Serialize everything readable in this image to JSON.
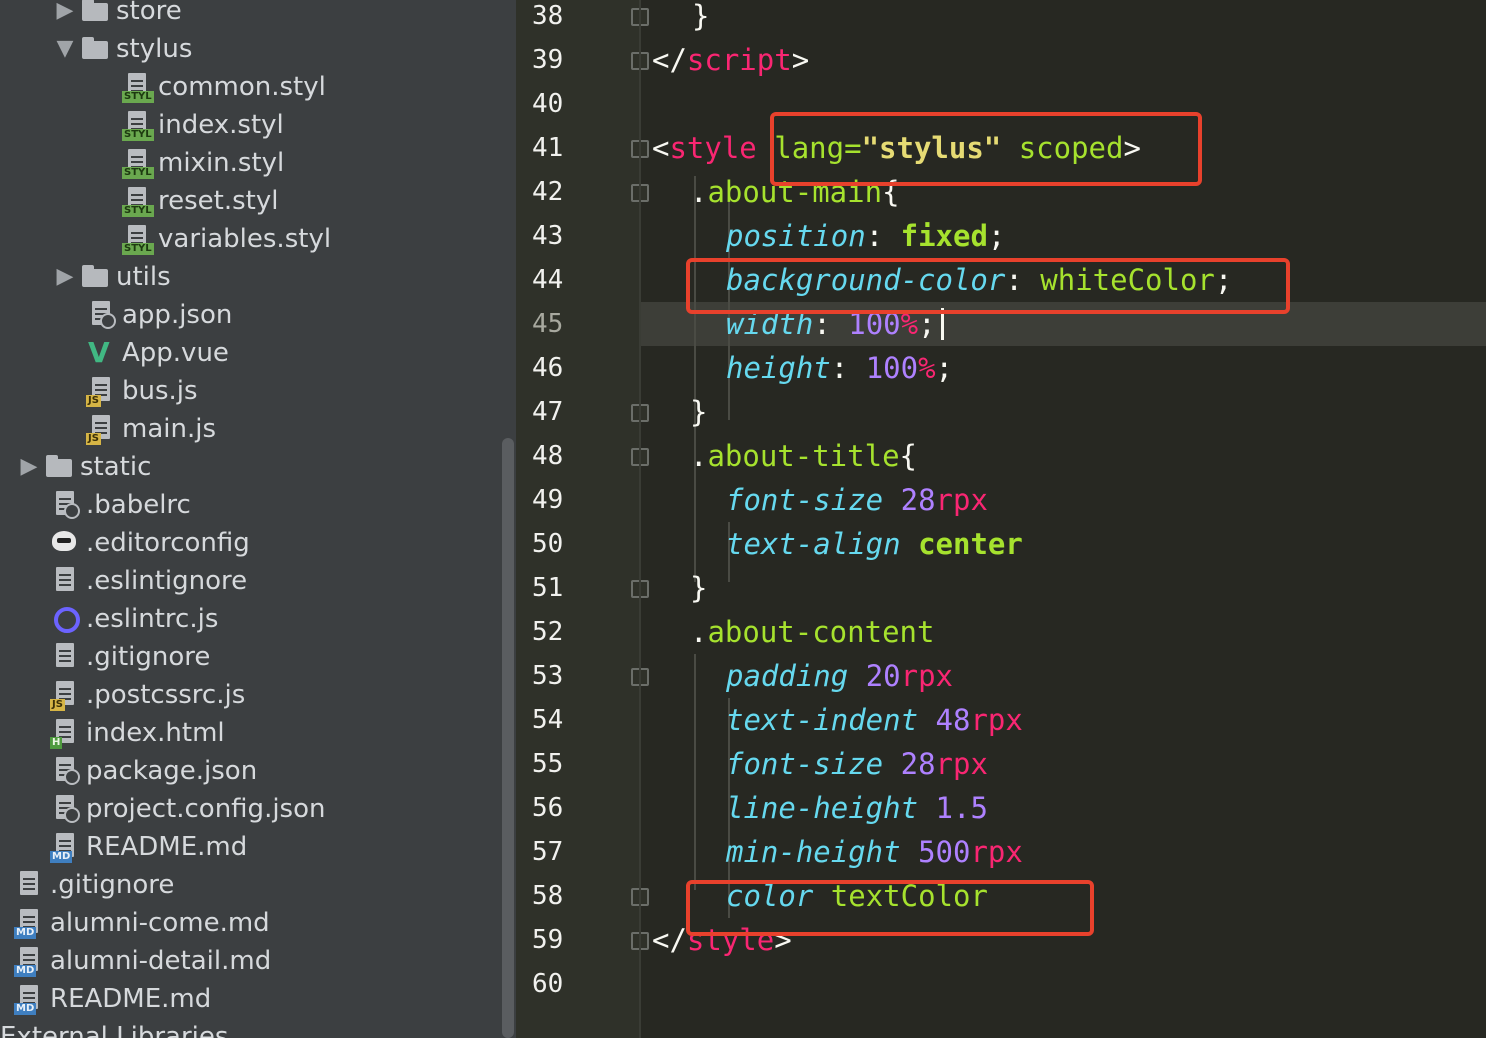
{
  "file_tree": [
    {
      "label": "store",
      "type": "folder",
      "state": "collapsed"
    },
    {
      "label": "stylus",
      "type": "folder",
      "state": "expanded"
    },
    {
      "label": "common.styl",
      "type": "file",
      "icon": "styl-file-icon"
    },
    {
      "label": "index.styl",
      "type": "file",
      "icon": "styl-file-icon"
    },
    {
      "label": "mixin.styl",
      "type": "file",
      "icon": "styl-file-icon"
    },
    {
      "label": "reset.styl",
      "type": "file",
      "icon": "styl-file-icon"
    },
    {
      "label": "variables.styl",
      "type": "file",
      "icon": "styl-file-icon"
    },
    {
      "label": "utils",
      "type": "folder",
      "state": "collapsed"
    },
    {
      "label": "app.json",
      "type": "file",
      "icon": "json-file-icon"
    },
    {
      "label": "App.vue",
      "type": "file",
      "icon": "vue-file-icon"
    },
    {
      "label": "bus.js",
      "type": "file",
      "icon": "js-file-icon"
    },
    {
      "label": "main.js",
      "type": "file",
      "icon": "js-file-icon"
    },
    {
      "label": "static",
      "type": "folder",
      "state": "collapsed"
    },
    {
      "label": ".babelrc",
      "type": "file",
      "icon": "config-file-icon"
    },
    {
      "label": ".editorconfig",
      "type": "file",
      "icon": "editorconfig-file-icon"
    },
    {
      "label": ".eslintignore",
      "type": "file",
      "icon": "text-file-icon"
    },
    {
      "label": ".eslintrc.js",
      "type": "file",
      "icon": "eslint-file-icon"
    },
    {
      "label": ".gitignore",
      "type": "file",
      "icon": "text-file-icon"
    },
    {
      "label": ".postcssrc.js",
      "type": "file",
      "icon": "js-file-icon"
    },
    {
      "label": "index.html",
      "type": "file",
      "icon": "html-file-icon"
    },
    {
      "label": "package.json",
      "type": "file",
      "icon": "json-file-icon"
    },
    {
      "label": "project.config.json",
      "type": "file",
      "icon": "json-file-icon"
    },
    {
      "label": "README.md",
      "type": "file",
      "icon": "md-file-icon"
    },
    {
      "label": ".gitignore",
      "type": "file",
      "icon": "text-file-icon"
    },
    {
      "label": "alumni-come.md",
      "type": "file",
      "icon": "md-file-icon"
    },
    {
      "label": "alumni-detail.md",
      "type": "file",
      "icon": "md-file-icon"
    },
    {
      "label": "README.md",
      "type": "file",
      "icon": "md-file-icon"
    },
    {
      "label": "External Libraries",
      "type": "library"
    }
  ],
  "icons": {
    "expanded": "▼",
    "collapsed": "▶",
    "styl_badge": "STYL",
    "js_badge": "JS",
    "md_badge": "MD",
    "html_badge": "H",
    "vue_glyph": "V",
    "gear_glyph": "{}"
  },
  "editor": {
    "current_line": 45,
    "line_numbers": [
      "38",
      "39",
      "40",
      "41",
      "42",
      "43",
      "44",
      "45",
      "46",
      "47",
      "48",
      "49",
      "50",
      "51",
      "52",
      "53",
      "54",
      "55",
      "56",
      "57",
      "58",
      "59",
      "60"
    ],
    "lines": [
      [
        {
          "t": "}",
          "c": "plain"
        }
      ],
      [
        {
          "t": "</",
          "c": "plain"
        },
        {
          "t": "script",
          "c": "tag"
        },
        {
          "t": ">",
          "c": "plain"
        }
      ],
      [],
      [
        {
          "t": "<",
          "c": "plain"
        },
        {
          "t": "style",
          "c": "tag"
        },
        {
          "t": " ",
          "c": "plain"
        },
        {
          "t": "lang=",
          "c": "attr"
        },
        {
          "t": "\"stylus\"",
          "c": "str"
        },
        {
          "t": " ",
          "c": "plain"
        },
        {
          "t": "scoped",
          "c": "attr"
        },
        {
          "t": ">",
          "c": "plain"
        }
      ],
      [
        {
          "t": ".",
          "c": "plain"
        },
        {
          "t": "about-main",
          "c": "sel"
        },
        {
          "t": "{",
          "c": "plain"
        }
      ],
      [
        {
          "t": "position",
          "c": "prop"
        },
        {
          "t": ": ",
          "c": "plain"
        },
        {
          "t": "fixed",
          "c": "kw"
        },
        {
          "t": ";",
          "c": "plain"
        }
      ],
      [
        {
          "t": "background-color",
          "c": "prop"
        },
        {
          "t": ": ",
          "c": "plain"
        },
        {
          "t": "whiteColor",
          "c": "attr"
        },
        {
          "t": ";",
          "c": "plain"
        }
      ],
      [
        {
          "t": "width",
          "c": "prop"
        },
        {
          "t": ": ",
          "c": "plain"
        },
        {
          "t": "100",
          "c": "num"
        },
        {
          "t": "%",
          "c": "unit"
        },
        {
          "t": ";",
          "c": "plain"
        }
      ],
      [
        {
          "t": "height",
          "c": "prop"
        },
        {
          "t": ": ",
          "c": "plain"
        },
        {
          "t": "100",
          "c": "num"
        },
        {
          "t": "%",
          "c": "unit"
        },
        {
          "t": ";",
          "c": "plain"
        }
      ],
      [
        {
          "t": "}",
          "c": "plain"
        }
      ],
      [
        {
          "t": ".",
          "c": "plain"
        },
        {
          "t": "about-title",
          "c": "sel"
        },
        {
          "t": "{",
          "c": "plain"
        }
      ],
      [
        {
          "t": "font-size",
          "c": "prop"
        },
        {
          "t": " ",
          "c": "plain"
        },
        {
          "t": "28",
          "c": "num"
        },
        {
          "t": "rpx",
          "c": "unit"
        }
      ],
      [
        {
          "t": "text-align",
          "c": "prop"
        },
        {
          "t": " ",
          "c": "plain"
        },
        {
          "t": "center",
          "c": "kw"
        }
      ],
      [
        {
          "t": "}",
          "c": "plain"
        }
      ],
      [
        {
          "t": ".",
          "c": "plain"
        },
        {
          "t": "about-content",
          "c": "sel"
        }
      ],
      [
        {
          "t": "padding",
          "c": "prop"
        },
        {
          "t": " ",
          "c": "plain"
        },
        {
          "t": "20",
          "c": "num"
        },
        {
          "t": "rpx",
          "c": "unit"
        }
      ],
      [
        {
          "t": "text-indent",
          "c": "prop"
        },
        {
          "t": " ",
          "c": "plain"
        },
        {
          "t": "48",
          "c": "num"
        },
        {
          "t": "rpx",
          "c": "unit"
        }
      ],
      [
        {
          "t": "font-size",
          "c": "prop"
        },
        {
          "t": " ",
          "c": "plain"
        },
        {
          "t": "28",
          "c": "num"
        },
        {
          "t": "rpx",
          "c": "unit"
        }
      ],
      [
        {
          "t": "line-height",
          "c": "prop"
        },
        {
          "t": " ",
          "c": "plain"
        },
        {
          "t": "1.5",
          "c": "num"
        }
      ],
      [
        {
          "t": "min-height",
          "c": "prop"
        },
        {
          "t": " ",
          "c": "plain"
        },
        {
          "t": "500",
          "c": "num"
        },
        {
          "t": "rpx",
          "c": "unit"
        }
      ],
      [
        {
          "t": "color",
          "c": "prop"
        },
        {
          "t": " ",
          "c": "plain"
        },
        {
          "t": "textColor",
          "c": "attr"
        }
      ],
      [
        {
          "t": "</",
          "c": "plain"
        },
        {
          "t": "style",
          "c": "tag"
        },
        {
          "t": ">",
          "c": "plain"
        }
      ],
      []
    ]
  },
  "colors": {
    "editor_bg": "#272822",
    "sidebar_bg": "#3c3f41",
    "annotation_red": "#e8412c",
    "tag_pink": "#f92672",
    "attr_green": "#a6e22e",
    "string_yellow": "#e6db74",
    "property_cyan": "#66d9ef",
    "number_purple": "#ae81ff"
  }
}
